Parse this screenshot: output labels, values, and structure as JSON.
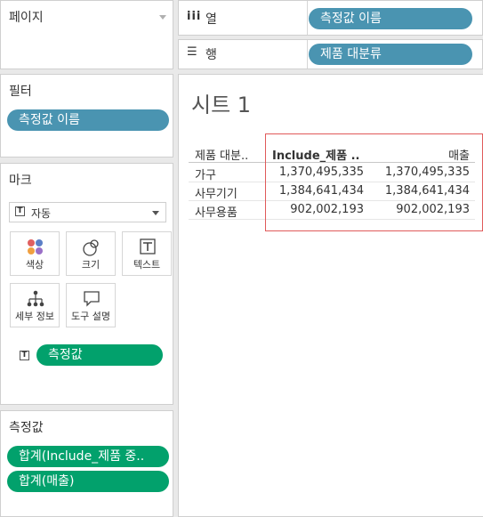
{
  "pages_panel": {
    "title": "페이지"
  },
  "filters_panel": {
    "title": "필터",
    "pill": "측정값 이름"
  },
  "marks_panel": {
    "title": "마크",
    "mark_type": "자동",
    "buttons": {
      "color": "색상",
      "size": "크기",
      "text": "텍스트",
      "detail": "세부 정보",
      "tooltip": "도구 설명"
    },
    "text_pill": "측정값"
  },
  "measures_panel": {
    "title": "측정값",
    "items": [
      "합계(Include_제품 중..",
      "합계(매출)"
    ]
  },
  "columns_shelf": {
    "icon": "iii",
    "label": "열",
    "pill": "측정값 이름"
  },
  "rows_shelf": {
    "icon": "☰",
    "label": "행",
    "pill": "제품 대분류"
  },
  "sheet": {
    "title": "시트 1",
    "headers": [
      "제품 대분..",
      "Include_제품 ..",
      "매출"
    ],
    "rows": [
      [
        "가구",
        "1,370,495,335",
        "1,370,495,335"
      ],
      [
        "사무기기",
        "1,384,641,434",
        "1,384,641,434"
      ],
      [
        "사무용품",
        "902,002,193",
        "902,002,193"
      ]
    ]
  },
  "colors": {
    "blue_pill": "#4a94b1",
    "green_pill": "#02a16c",
    "highlight": "#e05a5a"
  }
}
